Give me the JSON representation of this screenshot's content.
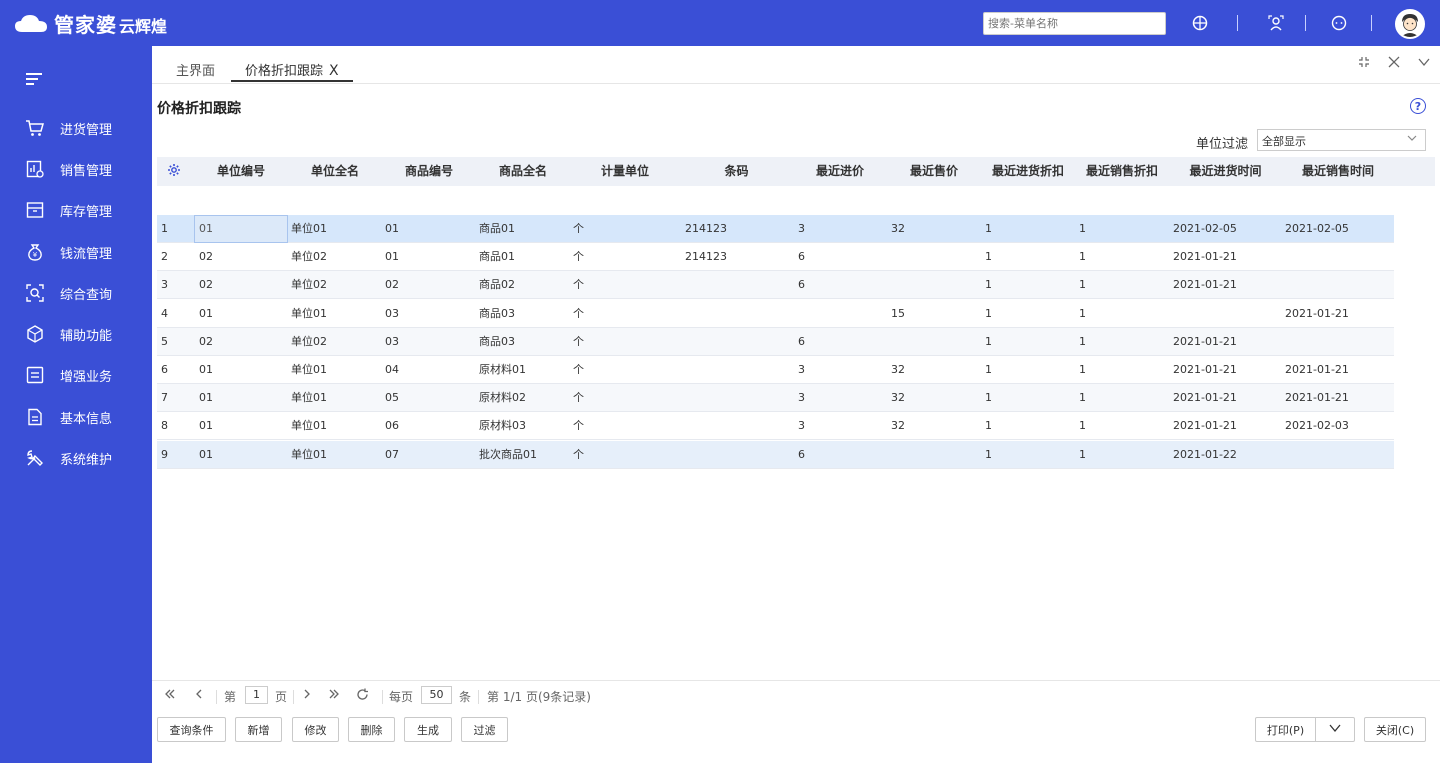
{
  "app": {
    "brand": "管家婆",
    "brand_sub": "云辉煌",
    "search_placeholder": "搜索-菜单名称"
  },
  "sidebar": {
    "items": [
      {
        "label": "进货管理",
        "icon": "cart-icon"
      },
      {
        "label": "销售管理",
        "icon": "sales-chart-icon"
      },
      {
        "label": "库存管理",
        "icon": "box-icon"
      },
      {
        "label": "钱流管理",
        "icon": "money-bag-icon"
      },
      {
        "label": "综合查询",
        "icon": "search-scan-icon"
      },
      {
        "label": "辅助功能",
        "icon": "hexagon-icon"
      },
      {
        "label": "增强业务",
        "icon": "list-icon"
      },
      {
        "label": "基本信息",
        "icon": "document-icon"
      },
      {
        "label": "系统维护",
        "icon": "tools-icon"
      }
    ]
  },
  "tabs": {
    "home": "主界面",
    "active": "价格折扣跟踪",
    "close": "X"
  },
  "page": {
    "title": "价格折扣跟踪",
    "help": "?",
    "filter_label": "单位过滤",
    "filter_value": "全部显示"
  },
  "table": {
    "columns": [
      "单位编号",
      "单位全名",
      "商品编号",
      "商品全名",
      "计量单位",
      "条码",
      "最近进价",
      "最近售价",
      "最近进货折扣",
      "最近销售折扣",
      "最近进货时间",
      "最近销售时间"
    ],
    "rows": [
      [
        "1",
        "01",
        "单位01",
        "01",
        "商品01",
        "个",
        "214123",
        "3",
        "32",
        "1",
        "1",
        "2021-02-05",
        "2021-02-05"
      ],
      [
        "2",
        "02",
        "单位02",
        "01",
        "商品01",
        "个",
        "214123",
        "6",
        "",
        "1",
        "1",
        "2021-01-21",
        ""
      ],
      [
        "3",
        "02",
        "单位02",
        "02",
        "商品02",
        "个",
        "",
        "6",
        "",
        "1",
        "1",
        "2021-01-21",
        ""
      ],
      [
        "4",
        "01",
        "单位01",
        "03",
        "商品03",
        "个",
        "",
        "",
        "15",
        "1",
        "1",
        "",
        "2021-01-21"
      ],
      [
        "5",
        "02",
        "单位02",
        "03",
        "商品03",
        "个",
        "",
        "6",
        "",
        "1",
        "1",
        "2021-01-21",
        ""
      ],
      [
        "6",
        "01",
        "单位01",
        "04",
        "原材料01",
        "个",
        "",
        "3",
        "32",
        "1",
        "1",
        "2021-01-21",
        "2021-01-21"
      ],
      [
        "7",
        "01",
        "单位01",
        "05",
        "原材料02",
        "个",
        "",
        "3",
        "32",
        "1",
        "1",
        "2021-01-21",
        "2021-01-21"
      ],
      [
        "8",
        "01",
        "单位01",
        "06",
        "原材料03",
        "个",
        "",
        "3",
        "32",
        "1",
        "1",
        "2021-01-21",
        "2021-02-03"
      ],
      [
        "9",
        "01",
        "单位01",
        "07",
        "批次商品01",
        "个",
        "",
        "6",
        "",
        "1",
        "1",
        "2021-01-22",
        ""
      ]
    ]
  },
  "pager": {
    "page_prefix": "第",
    "page": "1",
    "page_suffix": "页",
    "per_page_prefix": "每页",
    "per_page": "50",
    "per_page_suffix": "条",
    "summary": "第 1/1 页(9条记录)"
  },
  "buttons": {
    "query": "查询条件",
    "add": "新增",
    "edit": "修改",
    "delete": "删除",
    "generate": "生成",
    "filter": "过滤",
    "print": "打印(P)",
    "close": "关闭(C)"
  },
  "colors": {
    "brand": "#3a4fd6",
    "selected_row": "#d6e7fb",
    "header_bg": "#eef1f7"
  }
}
